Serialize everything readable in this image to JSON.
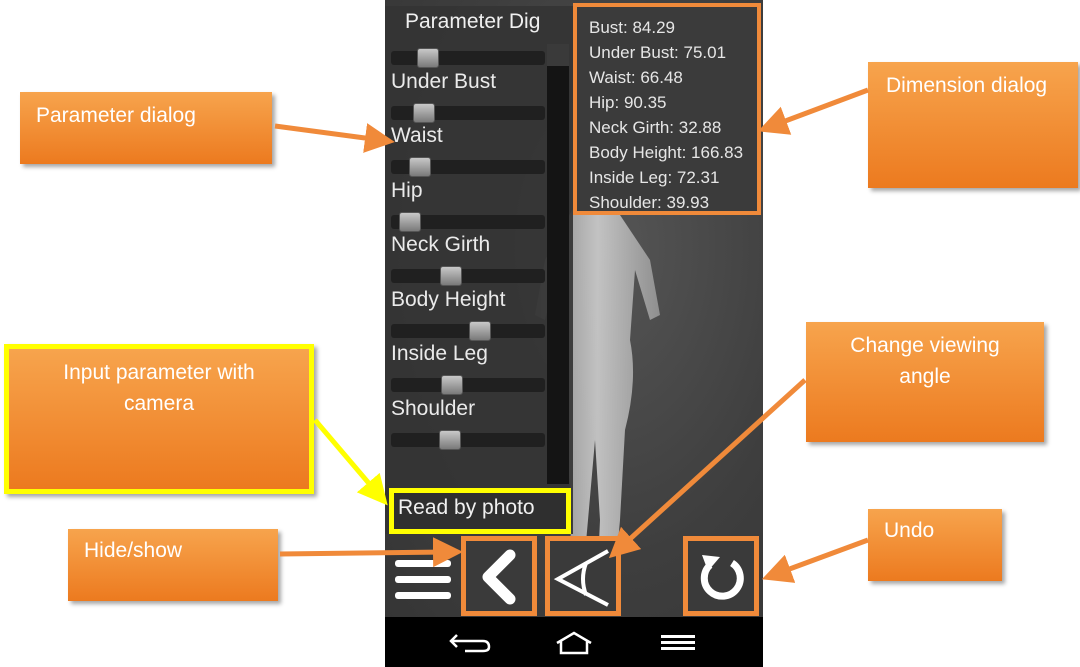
{
  "parameter_dialog": {
    "title": "Parameter Dig",
    "sliders": [
      {
        "label": "",
        "value": 0.2
      },
      {
        "label": "Under Bust",
        "value": 0.17
      },
      {
        "label": "Waist",
        "value": 0.14
      },
      {
        "label": "Hip",
        "value": 0.06
      },
      {
        "label": "Neck Girth",
        "value": 0.37
      },
      {
        "label": "Body Height",
        "value": 0.59
      },
      {
        "label": "Inside Leg",
        "value": 0.38
      },
      {
        "label": "Shoulder",
        "value": 0.36
      }
    ],
    "read_by_photo_label": "Read by photo"
  },
  "dimension_dialog": {
    "rows": [
      "Bust:    84.29",
      "Under Bust: 75.01",
      "Waist:   66.48",
      "Hip:   90.35",
      "Neck Girth: 32.88",
      "Body Height: 166.83",
      "Inside Leg:  72.31",
      "Shoulder:  39.93"
    ]
  },
  "callouts": {
    "parameter_dialog": "Parameter dialog",
    "dimension_dialog": "Dimension dialog",
    "input_with_camera_line1": "Input parameter with",
    "input_with_camera_line2": "camera",
    "change_angle_line1": "Change viewing",
    "change_angle_line2": "angle",
    "hide_show": "Hide/show",
    "undo": "Undo"
  },
  "colors": {
    "callout": "#f08a3a",
    "highlight_yellow": "#ffff00",
    "panel_bg": "#343434"
  },
  "icons": {
    "menu": "menu-icon",
    "hide_show": "chevron-left-icon",
    "view_angle": "view-angle-icon",
    "undo": "undo-icon",
    "nav_back": "back-icon",
    "nav_home": "home-icon",
    "nav_recents": "recents-icon"
  }
}
